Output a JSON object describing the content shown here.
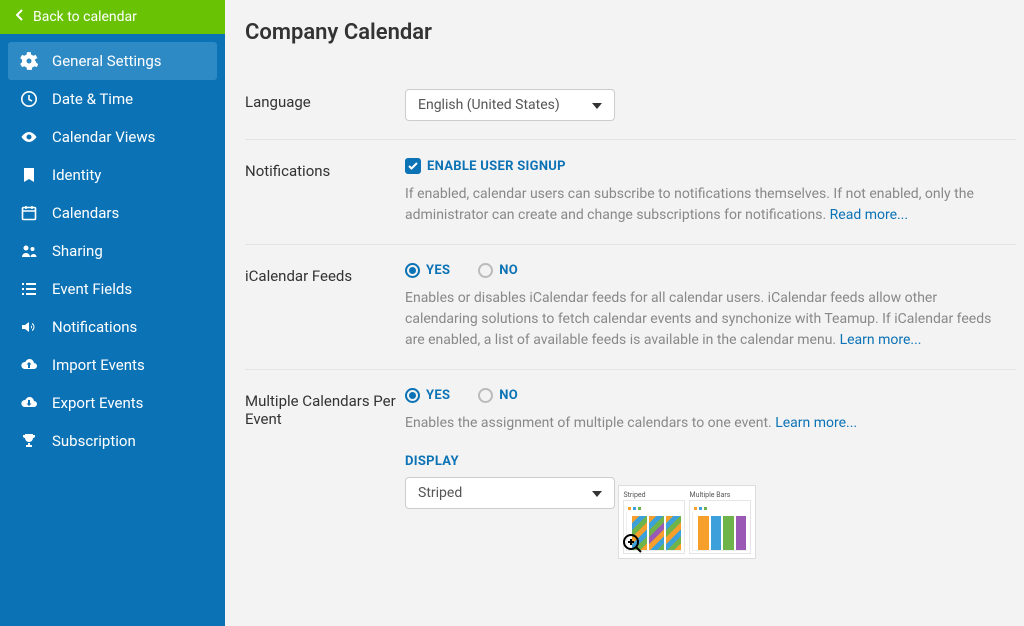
{
  "back_button": "Back to calendar",
  "page_title": "Company Calendar",
  "sidebar": {
    "items": [
      {
        "label": "General Settings"
      },
      {
        "label": "Date & Time"
      },
      {
        "label": "Calendar Views"
      },
      {
        "label": "Identity"
      },
      {
        "label": "Calendars"
      },
      {
        "label": "Sharing"
      },
      {
        "label": "Event Fields"
      },
      {
        "label": "Notifications"
      },
      {
        "label": "Import Events"
      },
      {
        "label": "Export Events"
      },
      {
        "label": "Subscription"
      }
    ]
  },
  "sections": {
    "language": {
      "label": "Language",
      "value": "English (United States)"
    },
    "notifications": {
      "label": "Notifications",
      "checkbox_label": "ENABLE USER SIGNUP",
      "checked": true,
      "desc": "If enabled, calendar users can subscribe to notifications themselves. If not enabled, only the administrator can create and change subscriptions for notifications. ",
      "link": "Read more..."
    },
    "ical": {
      "label": "iCalendar Feeds",
      "yes": "YES",
      "no": "NO",
      "selected": "yes",
      "desc": "Enables or disables iCalendar feeds for all calendar users. iCalendar feeds allow other calendaring solutions to fetch calendar events and synchonize with Teamup. If iCalendar feeds are enabled, a list of available feeds is available in the calendar menu. ",
      "link": "Learn more..."
    },
    "multi": {
      "label": "Multiple Calendars Per Event",
      "yes": "YES",
      "no": "NO",
      "selected": "yes",
      "desc": "Enables the assignment of multiple calendars to one event. ",
      "link": "Learn more...",
      "display_label": "DISPLAY",
      "display_value": "Striped",
      "preview_left": "Striped",
      "preview_right": "Multiple Bars"
    }
  },
  "colors": {
    "accent": "#0b72b5",
    "back_btn": "#6ac204"
  }
}
